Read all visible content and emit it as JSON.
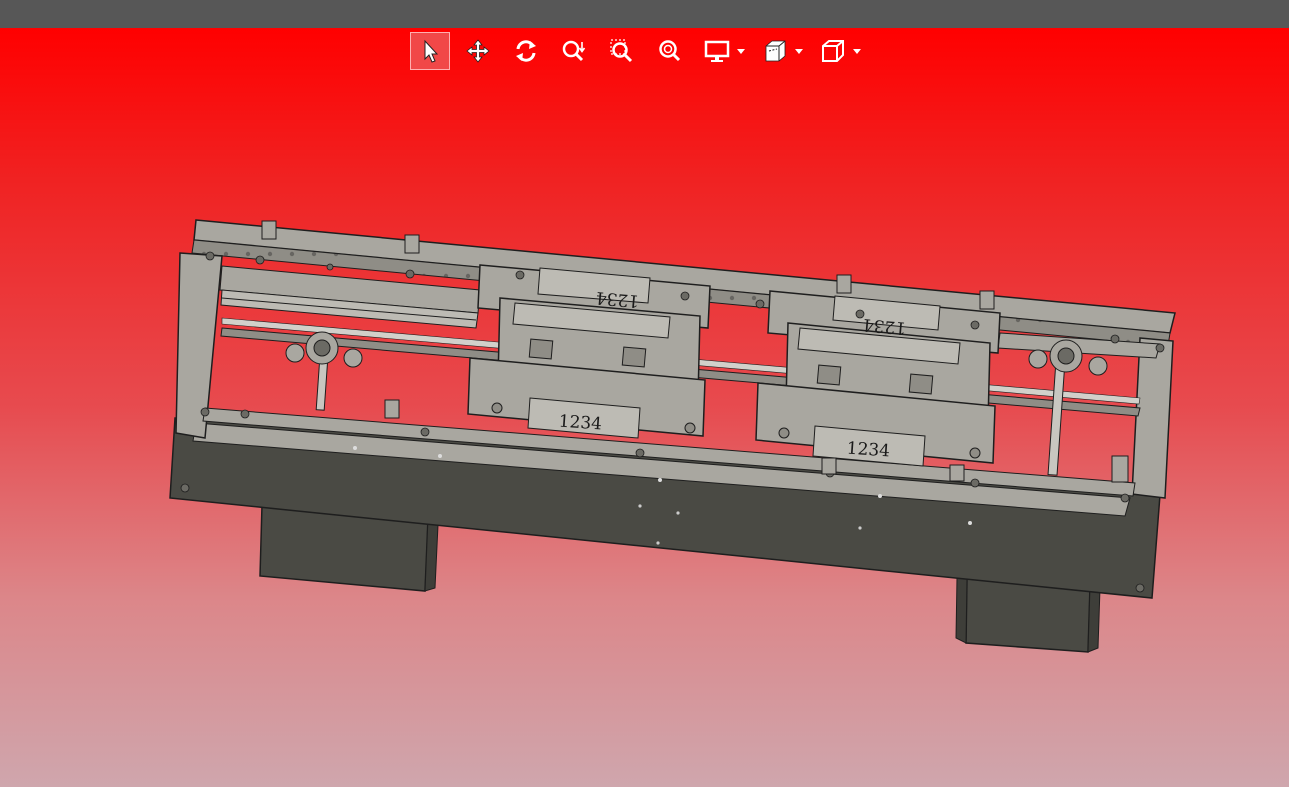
{
  "toolbar": {
    "buttons": [
      {
        "name": "select-tool",
        "icon": "cursor-arrow-icon",
        "active": true
      },
      {
        "name": "pan-tool",
        "icon": "move-arrows-icon",
        "active": false
      },
      {
        "name": "rotate-tool",
        "icon": "rotate-arrows-icon",
        "active": false
      },
      {
        "name": "zoom-tool",
        "icon": "zoom-drag-icon",
        "active": false
      },
      {
        "name": "zoom-window-tool",
        "icon": "zoom-window-icon",
        "active": false
      },
      {
        "name": "zoom-fit-tool",
        "icon": "zoom-fit-icon",
        "active": false
      }
    ],
    "dropdowns": [
      {
        "name": "display-mode",
        "icon": "monitor-icon"
      },
      {
        "name": "section-view",
        "icon": "section-box-icon"
      },
      {
        "name": "view-orientation",
        "icon": "cube-icon"
      }
    ]
  },
  "model": {
    "labels": [
      "1234",
      "1234",
      "1234",
      "1234"
    ],
    "colors": {
      "background_top": "#ff0000",
      "background_bottom": "#cfa6ad",
      "metal_light": "#a9a7a0",
      "metal_dark": "#4a4a44",
      "edge": "#1e1e1e"
    }
  }
}
